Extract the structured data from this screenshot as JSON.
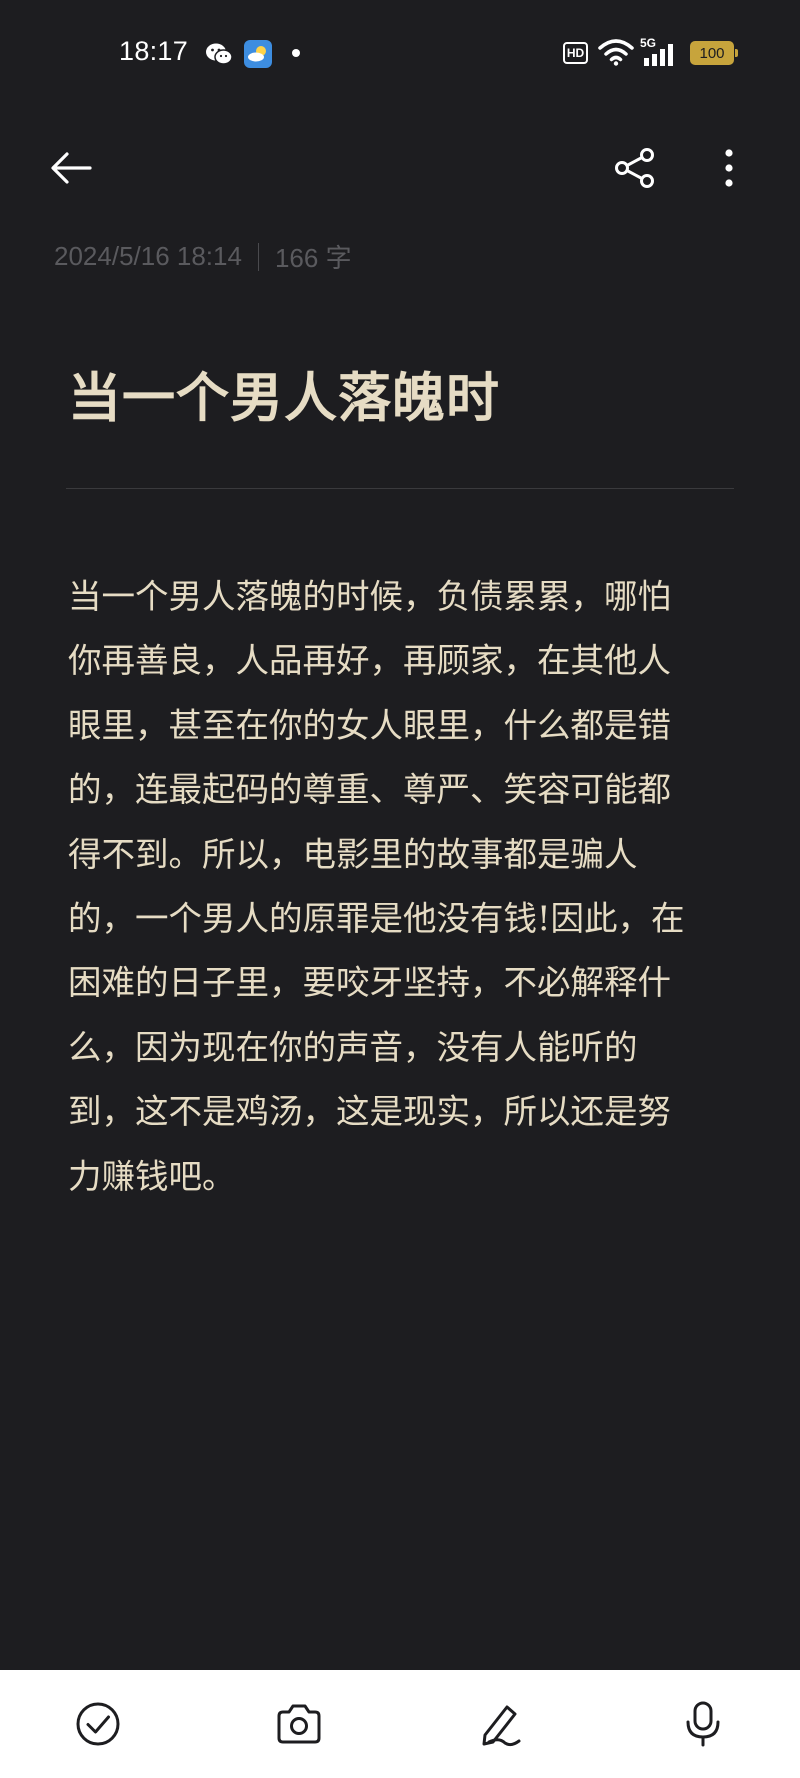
{
  "status_bar": {
    "time": "18:17",
    "icons": [
      "wechat-icon",
      "weather-app-icon",
      "notification-dot",
      "hd-icon",
      "wifi-icon",
      "5g-signal-icon",
      "battery-icon"
    ],
    "network_label": "5G",
    "hd_label": "HD",
    "battery_level": "100",
    "battery_fraction": 1.0
  },
  "toolbar": {
    "back_icon": "arrow-left-icon",
    "share_icon": "share-icon",
    "more_icon": "more-vertical-icon"
  },
  "note": {
    "date": "2024/5/16 18:14",
    "word_count": "166 字",
    "title": "当一个男人落魄时",
    "body_lines": [
      "当一个男人落魄的时候，负债累累，哪怕",
      "你再善良，人品再好，再顾家，在其他人",
      "眼里，甚至在你的女人眼里，什么都是错",
      "的，连最起码的尊重、尊严、笑容可能都",
      "得不到。所以，电影里的故事都是骗人",
      "的，一个男人的原罪是他没有钱!因此，在",
      "困难的日子里，要咬牙坚持，不必解释什",
      "么，因为现在你的声音，没有人能听的",
      "到，这不是鸡汤，这是现实，所以还是努",
      "力赚钱吧。"
    ]
  },
  "bottom_bar": {
    "items": [
      {
        "icon": "checkmark-circle-icon"
      },
      {
        "icon": "camera-icon"
      },
      {
        "icon": "pen-icon"
      },
      {
        "icon": "microphone-icon"
      }
    ]
  },
  "colors": {
    "background": "#1d1d20",
    "text": "#e6dcc4",
    "meta_text": "#5a5a5e",
    "bottom_bar": "#ffffff",
    "accent_weather": "#3d8de0",
    "battery": "#c7a43c"
  }
}
